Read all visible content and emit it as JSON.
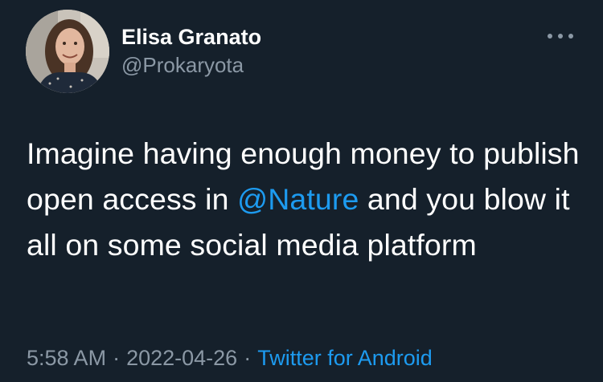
{
  "author": {
    "display_name": "Elisa Granato",
    "handle": "@Prokaryota"
  },
  "menu": {
    "icon": "more-horizontal-icon"
  },
  "tweet": {
    "text_before_mention": "Imagine having enough money to publish open access in ",
    "mention": "@Nature",
    "text_after_mention": " and you blow it all on some social media platform"
  },
  "meta": {
    "time": "5:58 AM",
    "date": "2022-04-26",
    "separator": "·",
    "source": "Twitter for Android"
  },
  "colors": {
    "background": "#15202b",
    "primary_text": "#ffffff",
    "secondary_text": "#8b98a5",
    "link": "#1d9bf0"
  }
}
